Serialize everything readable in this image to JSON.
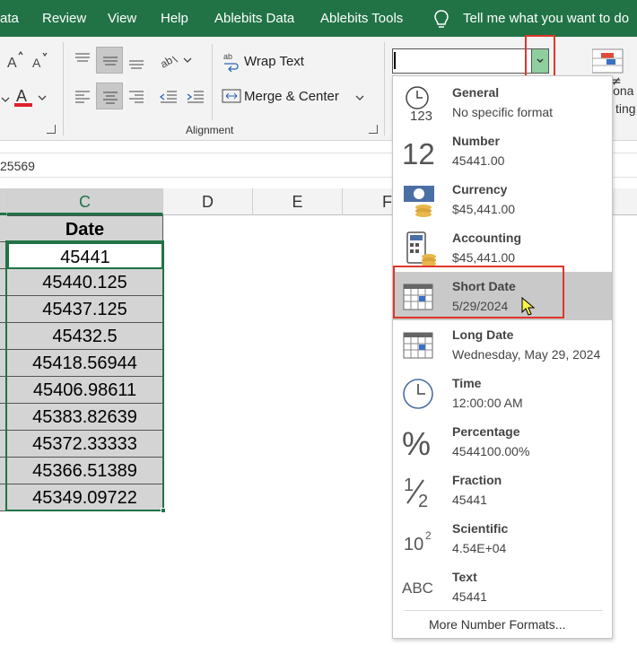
{
  "menu": {
    "tabs": [
      "ata",
      "Review",
      "View",
      "Help",
      "Ablebits Data",
      "Ablebits Tools"
    ],
    "tell_me": "Tell me what you want to do"
  },
  "ribbon": {
    "wrap_text": "Wrap Text",
    "merge_center": "Merge & Center",
    "alignment_label": "Alignment",
    "cond_format_partial_1": "iona",
    "cond_format_partial_2": "ting"
  },
  "number_format_box": {
    "value": ""
  },
  "formula_bar": {
    "text": "25569"
  },
  "columns": [
    "C",
    "D",
    "E",
    "F"
  ],
  "sheet": {
    "header": "Date",
    "values": [
      "45441",
      "45440.125",
      "45437.125",
      "45432.5",
      "45418.56944",
      "45406.98611",
      "45383.82639",
      "45372.33333",
      "45366.51389",
      "45349.09722"
    ]
  },
  "dropdown": {
    "items": [
      {
        "name": "General",
        "value": "No specific format",
        "icon": "general-icon"
      },
      {
        "name": "Number",
        "value": "45441.00",
        "icon": "number-icon"
      },
      {
        "name": "Currency",
        "value": "$45,441.00",
        "icon": "currency-icon"
      },
      {
        "name": "Accounting",
        "value": " $45,441.00",
        "icon": "accounting-icon"
      },
      {
        "name": "Short Date",
        "value": "5/29/2024",
        "icon": "calendar-icon"
      },
      {
        "name": "Long Date",
        "value": "Wednesday, May 29, 2024",
        "icon": "calendar-icon"
      },
      {
        "name": "Time",
        "value": "12:00:00 AM",
        "icon": "clock-icon"
      },
      {
        "name": "Percentage",
        "value": "4544100.00%",
        "icon": "percent-icon"
      },
      {
        "name": "Fraction",
        "value": "45441",
        "icon": "fraction-icon"
      },
      {
        "name": "Scientific",
        "value": "4.54E+04",
        "icon": "scientific-icon"
      },
      {
        "name": "Text",
        "value": "45441",
        "icon": "text-abc-icon"
      }
    ],
    "highlighted": "Short Date",
    "more": "More Number Formats..."
  },
  "icon_text": {
    "general_123": "123",
    "number_12": "12",
    "percent": "%",
    "sci_base": "10",
    "sci_exp": "2",
    "abc": "ABC"
  },
  "colors": {
    "excel_green": "#217346",
    "highlight_red": "#e0352b",
    "hover_gray": "#c9c9c9"
  }
}
